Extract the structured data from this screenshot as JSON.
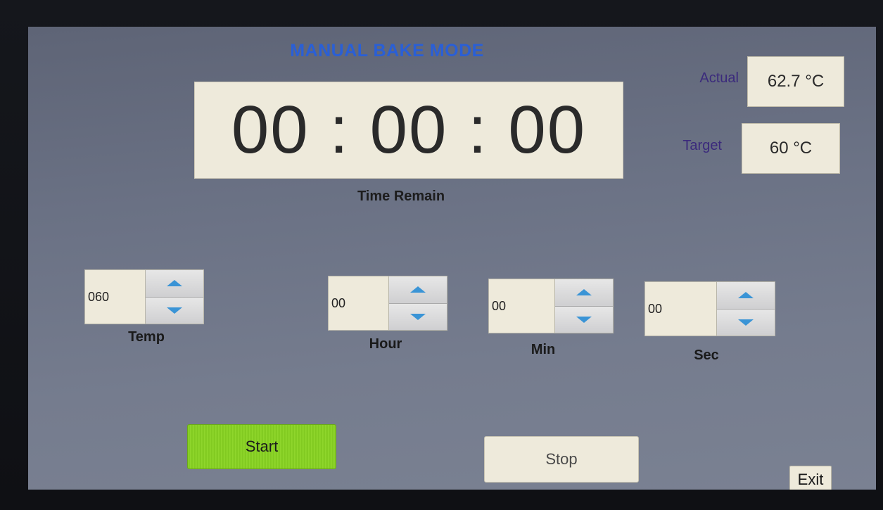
{
  "screen": {
    "title": "MANUAL BAKE MODE",
    "timer": {
      "value": "00:00:00",
      "caption": "Time Remain"
    },
    "readouts": {
      "actual_label": "Actual",
      "actual_value": "62.7 °C",
      "target_label": "Target",
      "target_value": "60 °C"
    },
    "spinners": [
      {
        "label": "Temp",
        "value": "060"
      },
      {
        "label": "Hour",
        "value": "00"
      },
      {
        "label": "Min",
        "value": "00"
      },
      {
        "label": "Sec",
        "value": "00"
      }
    ],
    "buttons": {
      "start": "Start",
      "stop": "Stop",
      "exit": "Exit"
    },
    "colors": {
      "title": "#2a5fd6",
      "start_button": "#8fd62a",
      "arrow": "#3a94d6",
      "label_purple": "#3b2a7c"
    }
  }
}
